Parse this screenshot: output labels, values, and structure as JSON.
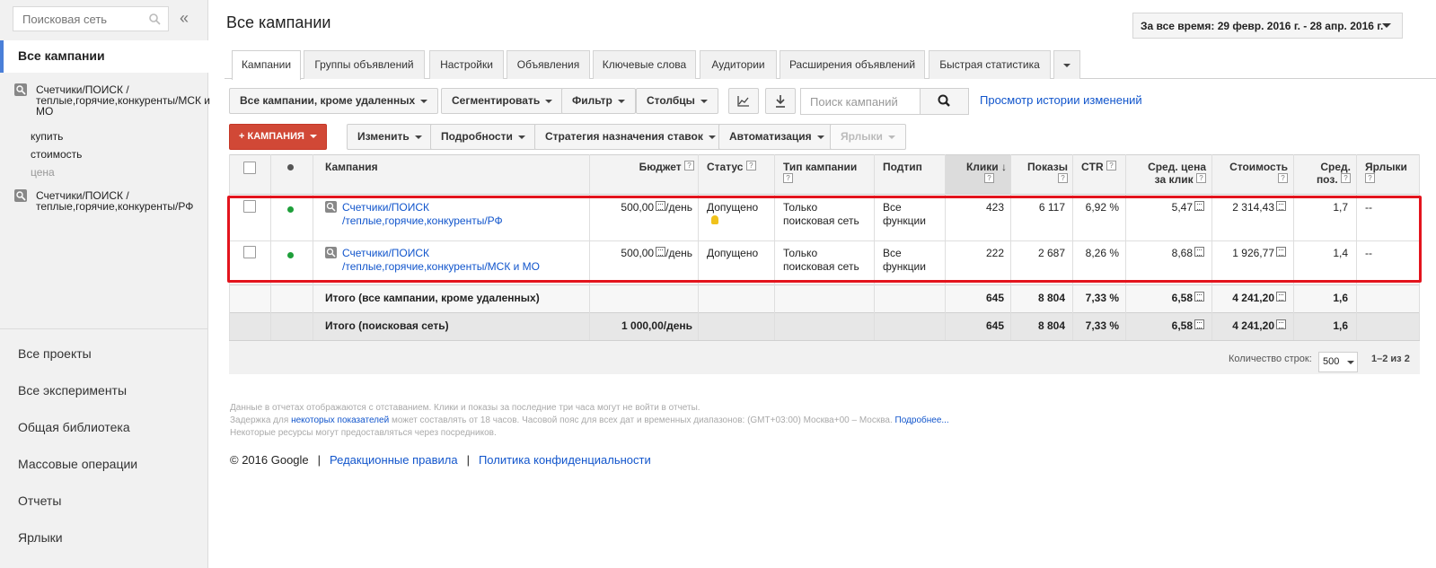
{
  "sidebar": {
    "search_placeholder": "Поисковая сеть",
    "collapse": "«",
    "selected": "Все кампании",
    "campaigns": [
      {
        "name": "Счетчики/ПОИСК /теплые,горячие,конкуренты/МСК и МО",
        "icon": "search-icon"
      },
      {
        "name": "Счетчики/ПОИСК /теплые,горячие,конкуренты/РФ",
        "icon": "search-icon"
      }
    ],
    "sub_items": [
      "купить",
      "стоимость",
      "цена"
    ],
    "nav": [
      "Все проекты",
      "Все эксперименты",
      "Общая библиотека",
      "Массовые операции",
      "Отчеты",
      "Ярлыки"
    ]
  },
  "header": {
    "title": "Все кампании",
    "date_range": "За все время: 29 февр. 2016 г. - 28 апр. 2016 г."
  },
  "tabs": [
    "Кампании",
    "Группы объявлений",
    "Настройки",
    "Объявления",
    "Ключевые слова",
    "Аудитории",
    "Расширения объявлений",
    "Быстрая статистика"
  ],
  "toolbar1": {
    "view_filter": "Все кампании, кроме удаленных",
    "segment": "Сегментировать",
    "filter": "Фильтр",
    "columns": "Столбцы",
    "search_placeholder": "Поиск кампаний",
    "history_link": "Просмотр истории изменений"
  },
  "toolbar2": {
    "add_campaign": "+ КАМПАНИЯ",
    "edit": "Изменить",
    "details": "Подробности",
    "bid_strategy": "Стратегия назначения ставок",
    "automation": "Автоматизация",
    "labels": "Ярлыки"
  },
  "table": {
    "headers": {
      "campaign": "Кампания",
      "budget": "Бюджет",
      "status": "Статус",
      "campaign_type": "Тип кампании",
      "subtype": "Подтип",
      "clicks": "Клики",
      "impressions": "Показы",
      "ctr": "CTR",
      "avg_cpc_line1": "Сред. цена",
      "avg_cpc_line2": "за клик",
      "cost": "Стоимость",
      "avg_pos_line1": "Сред.",
      "avg_pos_line2": "поз.",
      "labels": "Ярлыки"
    },
    "rows": [
      {
        "campaign_line1": "Счетчики/ПОИСК",
        "campaign_line2": "/теплые,горячие,конкуренты/РФ",
        "budget": "500,00",
        "budget_unit": "/день",
        "status": "Допущено",
        "type_line1": "Только",
        "type_line2": "поисковая сеть",
        "subtype_line1": "Все",
        "subtype_line2": "функции",
        "clicks": "423",
        "impressions": "6 117",
        "ctr": "6,92 %",
        "avg_cpc": "5,47",
        "cost": "2 314,43",
        "avg_pos": "1,7",
        "labels": "--"
      },
      {
        "campaign_line1": "Счетчики/ПОИСК",
        "campaign_line2": "/теплые,горячие,конкуренты/МСК и МО",
        "budget": "500,00",
        "budget_unit": "/день",
        "status": "Допущено",
        "type_line1": "Только",
        "type_line2": "поисковая сеть",
        "subtype_line1": "Все",
        "subtype_line2": "функции",
        "clicks": "222",
        "impressions": "2 687",
        "ctr": "8,26 %",
        "avg_cpc": "8,68",
        "cost": "1 926,77",
        "avg_pos": "1,4",
        "labels": "--"
      }
    ],
    "totals": [
      {
        "label": "Итого (все кампании, кроме удаленных)",
        "budget": "",
        "clicks": "645",
        "impressions": "8 804",
        "ctr": "7,33 %",
        "avg_cpc": "6,58",
        "cost": "4 241,20",
        "avg_pos": "1,6"
      },
      {
        "label": "Итого (поисковая сеть)",
        "budget": "1 000,00",
        "budget_unit": "/день",
        "clicks": "645",
        "impressions": "8 804",
        "ctr": "7,33 %",
        "avg_cpc": "6,58",
        "cost": "4 241,20",
        "avg_pos": "1,6"
      }
    ]
  },
  "pagination": {
    "rows_label": "Количество строк:",
    "rows_value": "500",
    "range": "1–2 из 2"
  },
  "footer": {
    "line1": "Данные в отчетах отображаются с отставанием. Клики и показы за последние три часа могут не войти в отчеты.",
    "line2_pre": "Задержка для",
    "line2_link": "некоторых показателей",
    "line2_post": "может составлять от 18 часов. Часовой пояс для всех дат и временных диапазонов: (GMT+03:00) Москва+00 – Москва.",
    "line2_more": "Подробнее...",
    "line3": "Некоторые ресурсы могут предоставляться через посредников.",
    "copyright": "© 2016 Google",
    "sep": "|",
    "editorial": "Редакционные правила",
    "privacy": "Политика конфиденциальности"
  },
  "colors": {
    "accent_blue": "#4a7fd8",
    "link": "#1155cc",
    "add_button": "#d14836",
    "enabled_dot": "#1e9f3a",
    "highlight": "#e3141d"
  }
}
